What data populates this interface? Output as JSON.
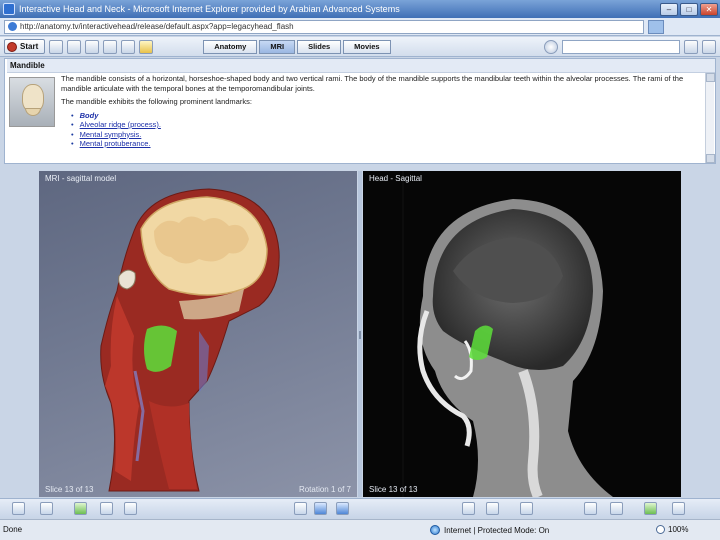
{
  "window": {
    "title": "Interactive Head and Neck - Microsoft Internet Explorer provided by Arabian Advanced Systems"
  },
  "address": {
    "url": "http://anatomy.tv/interactivehead/release/default.aspx?app=legacyhead_flash"
  },
  "toolbar": {
    "start_label": "Start",
    "tabs": [
      {
        "label": "Anatomy",
        "active": false
      },
      {
        "label": "MRI",
        "active": true
      },
      {
        "label": "Slides",
        "active": false
      },
      {
        "label": "Movies",
        "active": false
      }
    ],
    "search_value": ""
  },
  "info": {
    "title": "Mandible",
    "paragraph": "The mandible consists of a horizontal, horseshoe-shaped body and two vertical rami. The body of the mandible supports the mandibular teeth within the alveolar processes. The rami of the mandible articulate with the temporal bones at the temporomandibular joints.",
    "list_intro": "The mandible exhibits the following prominent landmarks:",
    "landmarks": [
      "Body",
      "Alveolar ridge (process).",
      "Mental symphysis.",
      "Mental protuberance."
    ]
  },
  "viewers": {
    "left": {
      "label": "MRI - sagittal model",
      "slice_text": "Slice 13 of 13",
      "rotation_text": "Rotation 1 of 7"
    },
    "right": {
      "label": "Head - Sagittal",
      "slice_text": "Slice 13 of 13"
    }
  },
  "status": {
    "left_text": "Done",
    "zone_text": "Internet | Protected Mode: On",
    "zoom_text": "100%"
  },
  "colors": {
    "highlight_green": "#5ddf3a",
    "titlebar": "#3f6fb5",
    "link_blue": "#1c2fa8"
  }
}
